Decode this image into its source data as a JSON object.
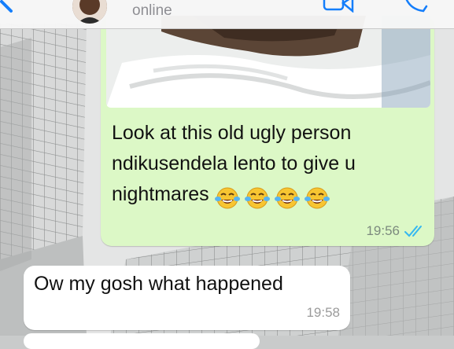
{
  "header": {
    "status": "online"
  },
  "messages": {
    "outgoing": {
      "text_lines": [
        "Look at this old ugly person",
        "ndikusendela lento to give u",
        "nightmares"
      ],
      "emoji_name": "face-with-tears-of-joy",
      "emoji_count": 4,
      "time": "19:56",
      "status_icon": "double-check-read-icon"
    },
    "incoming": {
      "text": "Ow my gosh what happened",
      "time": "19:58"
    }
  },
  "colors": {
    "outgoing_bubble": "#dcf8c6",
    "incoming_bubble": "#ffffff",
    "read_ticks": "#34b7f1",
    "ios_blue": "#147efb"
  }
}
